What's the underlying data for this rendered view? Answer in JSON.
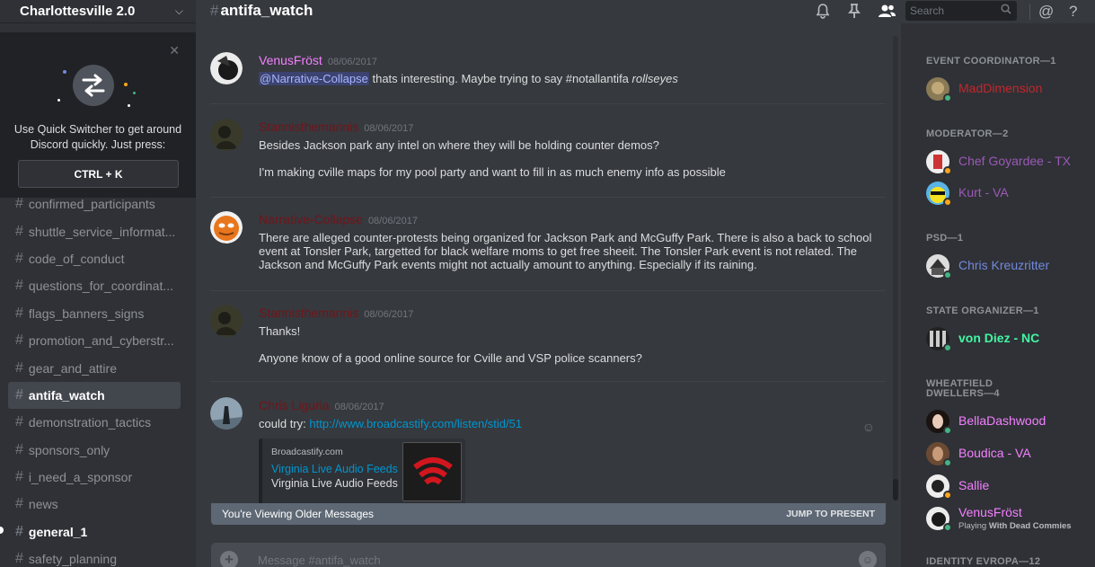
{
  "server": {
    "name": "Charlottesville 2.0"
  },
  "quick_switcher": {
    "text_line1": "Use Quick Switcher to get around",
    "text_line2": "Discord quickly. Just press:",
    "shortcut": "CTRL + K"
  },
  "channels": [
    {
      "name": "confirmed_participants",
      "state": "normal"
    },
    {
      "name": "shuttle_service_informat...",
      "state": "normal"
    },
    {
      "name": "code_of_conduct",
      "state": "normal"
    },
    {
      "name": "questions_for_coordinat...",
      "state": "normal"
    },
    {
      "name": "flags_banners_signs",
      "state": "normal"
    },
    {
      "name": "promotion_and_cyberstr...",
      "state": "normal"
    },
    {
      "name": "gear_and_attire",
      "state": "normal"
    },
    {
      "name": "antifa_watch",
      "state": "active"
    },
    {
      "name": "demonstration_tactics",
      "state": "normal"
    },
    {
      "name": "sponsors_only",
      "state": "normal"
    },
    {
      "name": "i_need_a_sponsor",
      "state": "normal"
    },
    {
      "name": "news",
      "state": "normal"
    },
    {
      "name": "general_1",
      "state": "unread"
    },
    {
      "name": "safety_planning",
      "state": "normal"
    }
  ],
  "header": {
    "hash": "#",
    "channel_name": "antifa_watch",
    "search_placeholder": "Search",
    "icons": [
      "bell-icon",
      "pin-icon",
      "members-icon",
      "search-icon",
      "mention-icon",
      "help-icon"
    ]
  },
  "messages": [
    {
      "author": "VenusFröst",
      "color": "#f47fff",
      "date": "08/06/2017",
      "mention": "@Narrative-Collapse",
      "line_after_mention": " thats interesting. Maybe trying to say #notallantifa ",
      "italic": "rollseyes"
    },
    {
      "author": "Stannisthemannis",
      "color": "#71151a",
      "date": "08/06/2017",
      "lines": [
        "Besides Jackson park any intel on where they will be holding counter demos?",
        "I'm making cville maps for my pool party and want to fill in as much enemy info as possible"
      ]
    },
    {
      "author": "Narrative-Collapse",
      "color": "#71151a",
      "date": "08/06/2017",
      "lines": [
        "There are alleged counter-protests being organized for Jackson Park and McGuffy Park. There is also a back to school event at Tonsler Park, targetted for black welfare moms to get free sheeit. The Tonsler Park event is not related. The Jackson and McGuffy Park events might not actually amount to anything. Especially if its raining."
      ]
    },
    {
      "author": "Stannisthemannis",
      "color": "#71151a",
      "date": "08/06/2017",
      "lines": [
        "Thanks!",
        "Anyone know of a good online source for Cville and VSP police scanners?"
      ]
    },
    {
      "author": "Chris Liguria",
      "color": "#71151a",
      "date": "08/06/2017",
      "text_prefix": "could try: ",
      "link": "http://www.broadcastify.com/listen/stid/51",
      "embed": {
        "provider": "Broadcastify.com",
        "title": "Virginia Live Audio Feeds",
        "description": "Virginia Live Audio Feeds"
      }
    }
  ],
  "older_bar": {
    "text": "You're Viewing Older Messages",
    "jump": "JUMP TO PRESENT"
  },
  "composer": {
    "placeholder": "Message #antifa_watch"
  },
  "member_groups": [
    {
      "role": "EVENT COORDINATOR—1",
      "members": [
        {
          "name": "MadDimension",
          "color": "#c1272d",
          "status": "online"
        }
      ]
    },
    {
      "role": "MODERATOR—2",
      "members": [
        {
          "name": "Chef Goyardee - TX",
          "color": "#9b59b6",
          "status": "idle"
        },
        {
          "name": "Kurt - VA",
          "color": "#9b59b6",
          "status": "idle"
        }
      ]
    },
    {
      "role": "PSD—1",
      "members": [
        {
          "name": "Chris Kreuzritter",
          "color": "#7289da",
          "status": "online"
        }
      ]
    },
    {
      "role": "STATE ORGANIZER—1",
      "members": [
        {
          "name": "von Diez - NC",
          "color": "#43f5a3",
          "status": "online"
        }
      ]
    },
    {
      "role_line1": "WHEATFIELD",
      "role": "DWELLERS—4",
      "members": [
        {
          "name": "BellaDashwood",
          "color": "#f47fff",
          "status": "online"
        },
        {
          "name": "Boudica - VA",
          "color": "#f47fff",
          "status": "online"
        },
        {
          "name": "Sallie",
          "color": "#f47fff",
          "status": "idle"
        },
        {
          "name": "VenusFröst",
          "color": "#f47fff",
          "status": "online",
          "activity_prefix": "Playing ",
          "activity": "With Dead Commies"
        }
      ]
    },
    {
      "role": "IDENTITY EVROPA—12",
      "members": []
    }
  ],
  "colors": {
    "sidebar_bg": "#2f3136",
    "chat_bg": "#36393e",
    "link": "#0096cf",
    "online": "#43b581",
    "idle": "#faa61a"
  }
}
